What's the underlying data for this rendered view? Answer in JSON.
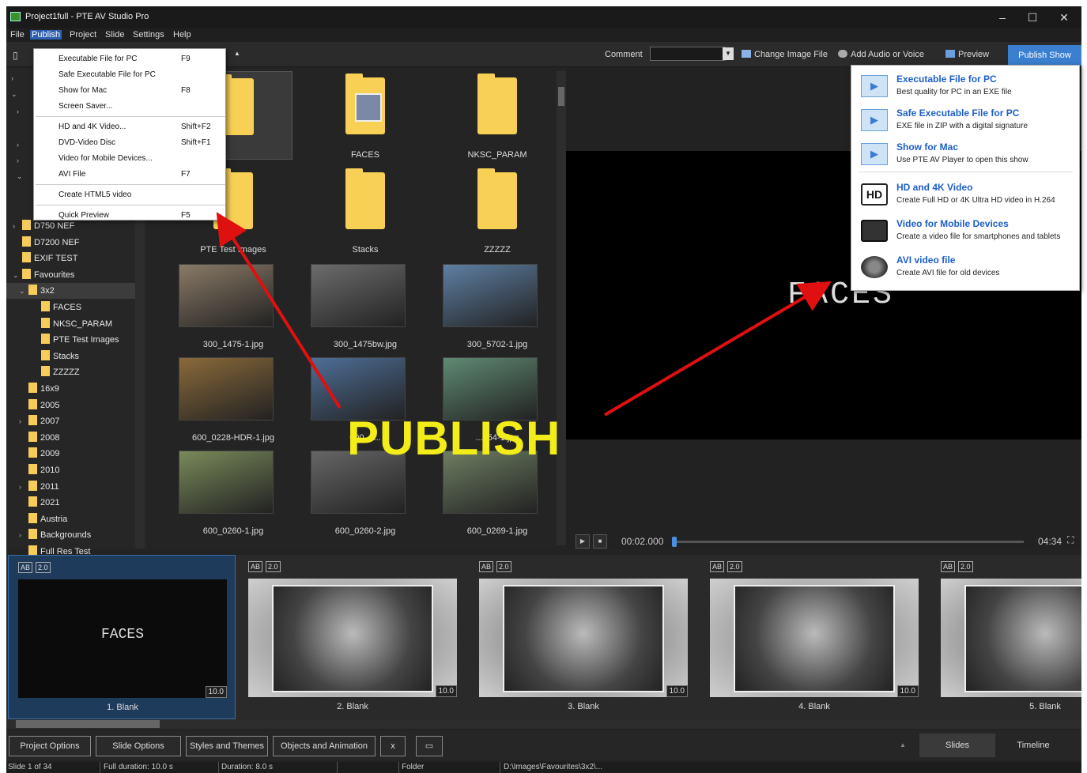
{
  "window": {
    "title": "Project1full - PTE AV Studio Pro",
    "controls": [
      "–",
      "☐",
      "✕"
    ]
  },
  "menubar": [
    "File",
    "Publish",
    "Project",
    "Slide",
    "Settings",
    "Help"
  ],
  "publish_menu": [
    {
      "label": "Executable File for PC",
      "key": "F9"
    },
    {
      "label": "Safe Executable File for PC",
      "key": ""
    },
    {
      "label": "Show for Mac",
      "key": "F8"
    },
    {
      "label": "Screen Saver...",
      "key": ""
    },
    {
      "label": "HD and 4K Video...",
      "key": "Shift+F2"
    },
    {
      "label": "DVD-Video Disc",
      "key": "Shift+F1"
    },
    {
      "label": "Video for Mobile Devices...",
      "key": ""
    },
    {
      "label": "AVI File",
      "key": "F7"
    },
    {
      "label": "Create HTML5 video",
      "key": ""
    },
    {
      "label": "Quick Preview",
      "key": "F5"
    }
  ],
  "toolbar": {
    "comment_label": "Comment",
    "change_image": "Change Image File",
    "add_audio": "Add Audio or Voice",
    "preview": "Preview",
    "publish_show": "Publish Show"
  },
  "publish_panel": [
    {
      "title": "Executable File for PC",
      "desc": "Best quality for PC in an EXE file",
      "icon": "play-icon"
    },
    {
      "title": "Safe Executable File for PC",
      "desc": "EXE file in ZIP with a digital signature",
      "icon": "play-icon"
    },
    {
      "title": "Show for Mac",
      "desc": "Use PTE AV Player to open this show",
      "icon": "play-icon"
    },
    {
      "title": "HD and 4K Video",
      "desc": "Create Full HD or 4K Ultra HD video in H.264",
      "icon": "hd-icon"
    },
    {
      "title": "Video for Mobile Devices",
      "desc": "Create a video file for smartphones and tablets",
      "icon": "tablet-icon"
    },
    {
      "title": "AVI video file",
      "desc": "Create AVI file for old devices",
      "icon": "film-reel-icon"
    }
  ],
  "tree": [
    {
      "label": "D750 NEF",
      "indent": 1,
      "exp": "›"
    },
    {
      "label": "D7200 NEF",
      "indent": 1,
      "exp": ""
    },
    {
      "label": "EXIF TEST",
      "indent": 1,
      "exp": ""
    },
    {
      "label": "Favourites",
      "indent": 1,
      "exp": "⌄"
    },
    {
      "label": "3x2",
      "indent": 2,
      "exp": "⌄",
      "selected": true
    },
    {
      "label": "FACES",
      "indent": 3,
      "exp": ""
    },
    {
      "label": "NKSC_PARAM",
      "indent": 3,
      "exp": ""
    },
    {
      "label": "PTE Test Images",
      "indent": 3,
      "exp": ""
    },
    {
      "label": "Stacks",
      "indent": 3,
      "exp": ""
    },
    {
      "label": "ZZZZZ",
      "indent": 3,
      "exp": ""
    },
    {
      "label": "16x9",
      "indent": 2,
      "exp": ""
    },
    {
      "label": "2005",
      "indent": 2,
      "exp": ""
    },
    {
      "label": "2007",
      "indent": 2,
      "exp": "›"
    },
    {
      "label": "2008",
      "indent": 2,
      "exp": ""
    },
    {
      "label": "2009",
      "indent": 2,
      "exp": ""
    },
    {
      "label": "2010",
      "indent": 2,
      "exp": ""
    },
    {
      "label": "2011",
      "indent": 2,
      "exp": "›"
    },
    {
      "label": "2021",
      "indent": 2,
      "exp": ""
    },
    {
      "label": "Austria",
      "indent": 2,
      "exp": ""
    },
    {
      "label": "Backgrounds",
      "indent": 2,
      "exp": "›"
    },
    {
      "label": "Full Res Test",
      "indent": 2,
      "exp": ""
    }
  ],
  "files": [
    {
      "name": "",
      "kind": "folder"
    },
    {
      "name": "FACES",
      "kind": "folder-photo"
    },
    {
      "name": "NKSC_PARAM",
      "kind": "folder"
    },
    {
      "name": "PTE Test Images",
      "kind": "folder"
    },
    {
      "name": "Stacks",
      "kind": "folder"
    },
    {
      "name": "ZZZZZ",
      "kind": "folder"
    },
    {
      "name": "300_1475-1.jpg",
      "kind": "photo",
      "color": "#8a7a66"
    },
    {
      "name": "300_1475bw.jpg",
      "kind": "photo",
      "color": "#6c6c6c"
    },
    {
      "name": "300_5702-1.jpg",
      "kind": "photo",
      "color": "#5e7fa3"
    },
    {
      "name": "600_0228-HDR-1.jpg",
      "kind": "photo",
      "color": "#8a6a3a"
    },
    {
      "name": "600_0...",
      "kind": "photo",
      "color": "#4e6e96"
    },
    {
      "name": "...254-1.jpg",
      "kind": "photo",
      "color": "#5f8a73"
    },
    {
      "name": "600_0260-1.jpg",
      "kind": "photo",
      "color": "#7a8a5a"
    },
    {
      "name": "600_0260-2.jpg",
      "kind": "photo",
      "color": "#666666"
    },
    {
      "name": "600_0269-1.jpg",
      "kind": "photo",
      "color": "#6e7e62"
    }
  ],
  "preview": {
    "text": "FACES",
    "time_current": "00:02.000",
    "time_total": "04:34"
  },
  "slides": [
    {
      "label": "1. Blank",
      "badge": "AB",
      "ver": "2.0",
      "duration": "10.0",
      "text": "FACES",
      "selected": true
    },
    {
      "label": "2. Blank",
      "badge": "AB",
      "ver": "2.0",
      "duration": "10.0",
      "color": "#777"
    },
    {
      "label": "3. Blank",
      "badge": "AB",
      "ver": "2.0",
      "duration": "10.0",
      "color": "#6a6a6a"
    },
    {
      "label": "4. Blank",
      "badge": "AB",
      "ver": "2.0",
      "duration": "10.0",
      "color": "#7c7c7c"
    },
    {
      "label": "5. Blank",
      "badge": "AB",
      "ver": "2.0",
      "duration": "",
      "color": "#666"
    }
  ],
  "bottom_buttons": [
    "Project Options",
    "Slide Options",
    "Styles and Themes",
    "Objects and Animation",
    "x",
    "▭"
  ],
  "view_tabs": [
    "Slides",
    "Timeline"
  ],
  "status": {
    "slide": "Slide 1 of 34",
    "full_duration": "Full duration: 10.0 s",
    "duration": "Duration: 8.0 s",
    "folder": "Folder",
    "path": "D:\\Images\\Favourites\\3x2\\..."
  },
  "annotation": "PUBLISH",
  "annotation_color": "#f2ec18",
  "arrow_color": "#e01010"
}
